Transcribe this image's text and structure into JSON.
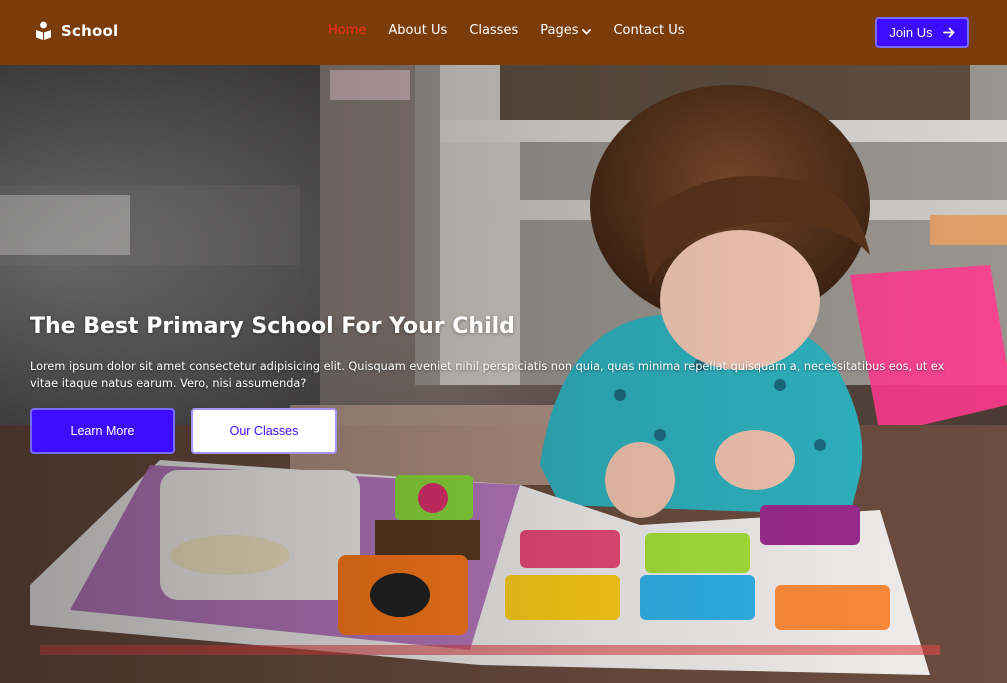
{
  "brand": {
    "name": "School",
    "icon": "school-logo-icon"
  },
  "nav": {
    "items": [
      {
        "label": "Home",
        "active": true
      },
      {
        "label": "About Us"
      },
      {
        "label": "Classes"
      },
      {
        "label": "Pages",
        "icon": "chevron-down-icon"
      },
      {
        "label": "Contact Us"
      }
    ],
    "cta": {
      "label": "Join Us",
      "icon": "arrow-right-icon"
    }
  },
  "hero": {
    "title": "The Best Primary School For Your Child",
    "text": "Lorem ipsum dolor sit amet consectetur adipisicing elit. Quisquam eveniet nihil perspiciatis non quia, quas minima repellat quisquam a, necessitatibus eos, ut ex vitae itaque natus earum. Vero, nisi assumenda?",
    "primary_button": "Learn More",
    "secondary_button": "Our Classes"
  },
  "colors": {
    "navbar_bg": "#7a3c0a",
    "active_link": "#ff2a1a",
    "primary": "#3d0bff",
    "white": "#ffffff"
  }
}
